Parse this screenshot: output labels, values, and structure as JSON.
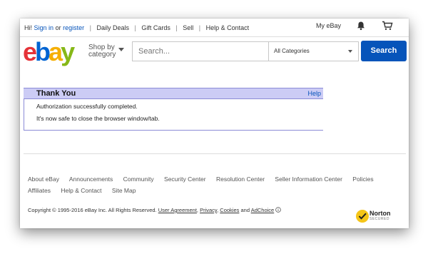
{
  "topbar": {
    "greeting": "Hi!",
    "sign_in": "Sign in",
    "or": "or",
    "register": "register",
    "daily_deals": "Daily Deals",
    "gift_cards": "Gift Cards",
    "sell": "Sell",
    "help_contact": "Help & Contact",
    "my_ebay": "My eBay"
  },
  "header": {
    "logo": {
      "e": "e",
      "b": "b",
      "a": "a",
      "y": "y"
    },
    "shop_by_line1": "Shop by",
    "shop_by_line2": "category",
    "search_placeholder": "Search...",
    "category_value": "All Categories",
    "search_button": "Search"
  },
  "panel": {
    "title": "Thank You",
    "help": "Help",
    "line1": "Authorization successfully completed.",
    "line2": "It's now safe to close the browser window/tab."
  },
  "footer": {
    "links": [
      "About eBay",
      "Announcements",
      "Community",
      "Security Center",
      "Resolution Center",
      "Seller Information Center",
      "Policies",
      "Affiliates",
      "Help & Contact",
      "Site Map"
    ],
    "copyright_prefix": "Copyright © 1995-2016 eBay Inc. All Rights Reserved.",
    "user_agreement": "User Agreement",
    "privacy": "Privacy",
    "cookies": "Cookies",
    "and": "and",
    "adchoice": "AdChoice",
    "norton": "Norton",
    "norton_sub": "SECURED"
  },
  "colors": {
    "link_blue": "#0654ba",
    "search_button": "#0654ba",
    "panel_header_bg": "#ccccf5",
    "logo_e": "#e53238",
    "logo_b": "#0064d2",
    "logo_a": "#f5af02",
    "logo_y": "#86b817"
  }
}
